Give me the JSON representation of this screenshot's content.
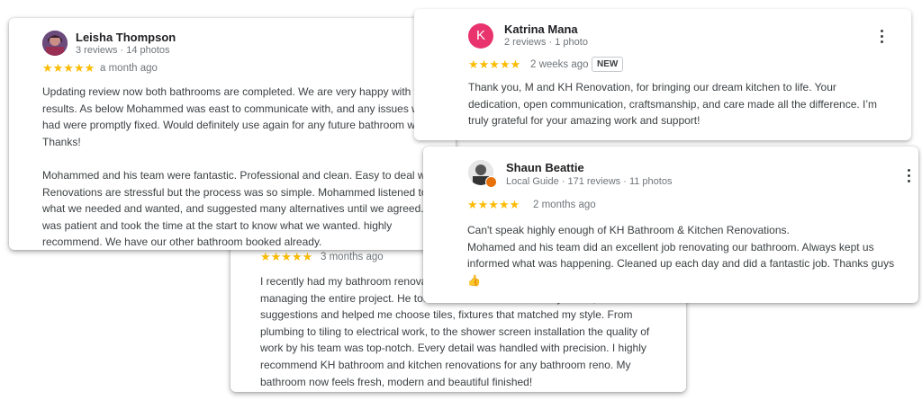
{
  "reviews": [
    {
      "name": "Leisha Thompson",
      "meta": "3 reviews · 14 photos",
      "stars": "★★★★★",
      "when": "a month ago",
      "paragraphs": [
        "Updating review now both bathrooms are completed. We are very happy with the results. As below Mohammed was east to communicate with, and any issues we had were promptly fixed. Would definitely use again for any future bathroom works. Thanks!",
        "Mohammed and his team were fantastic. Professional and clean. Easy to deal with. Renovations are stressful but the process was so simple. Mohammed listened to what we needed and wanted, and suggested many alternatives until we agreed.. he was patient and took the time at the start to know what we wanted. highly recommend. We have our other bathroom booked already."
      ]
    },
    {
      "name": "Katrina Mana",
      "initial": "K",
      "meta": "2 reviews · 1 photo",
      "stars": "★★★★★",
      "when": "2 weeks ago",
      "badge": "NEW",
      "text": "Thank you, M and KH Renovation, for bringing our dream kitchen to life. Your dedication, open communication, craftsmanship, and care made all the difference. I’m truly grateful for your amazing work and support!"
    },
    {
      "name": "Shaun Beattie",
      "meta": "Local Guide · 171 reviews · 11 photos",
      "stars": "★★★★★",
      "when": "2 months ago",
      "lines": [
        "Can't speak highly enough of KH Bathroom & Kitchen Renovations.",
        "Mohamed and his team did an excellent job renovating our bathroom. Always kept us informed what was happening. Cleaned up each day and did a fantastic job. Thanks guys 👍"
      ]
    },
    {
      "stars": "★★★★★",
      "when": "3 months ago",
      "text": "I recently had my bathroom renovated by KH Bathroom and Kitchen Renovations managing the entire project. He took the time to understand my vision, offered suggestions and helped me choose tiles, fixtures that matched my style. From plumbing to tiling to electrical work, to the shower screen installation the quality of work by his team was top-notch. Every detail was handled with precision. I highly recommend KH bathroom and kitchen renovations for any bathroom reno. My bathroom now feels fresh, modern and beautiful finished!"
    }
  ],
  "colors": {
    "star": "#fbbc04",
    "avatar_k": "#e8336d"
  }
}
